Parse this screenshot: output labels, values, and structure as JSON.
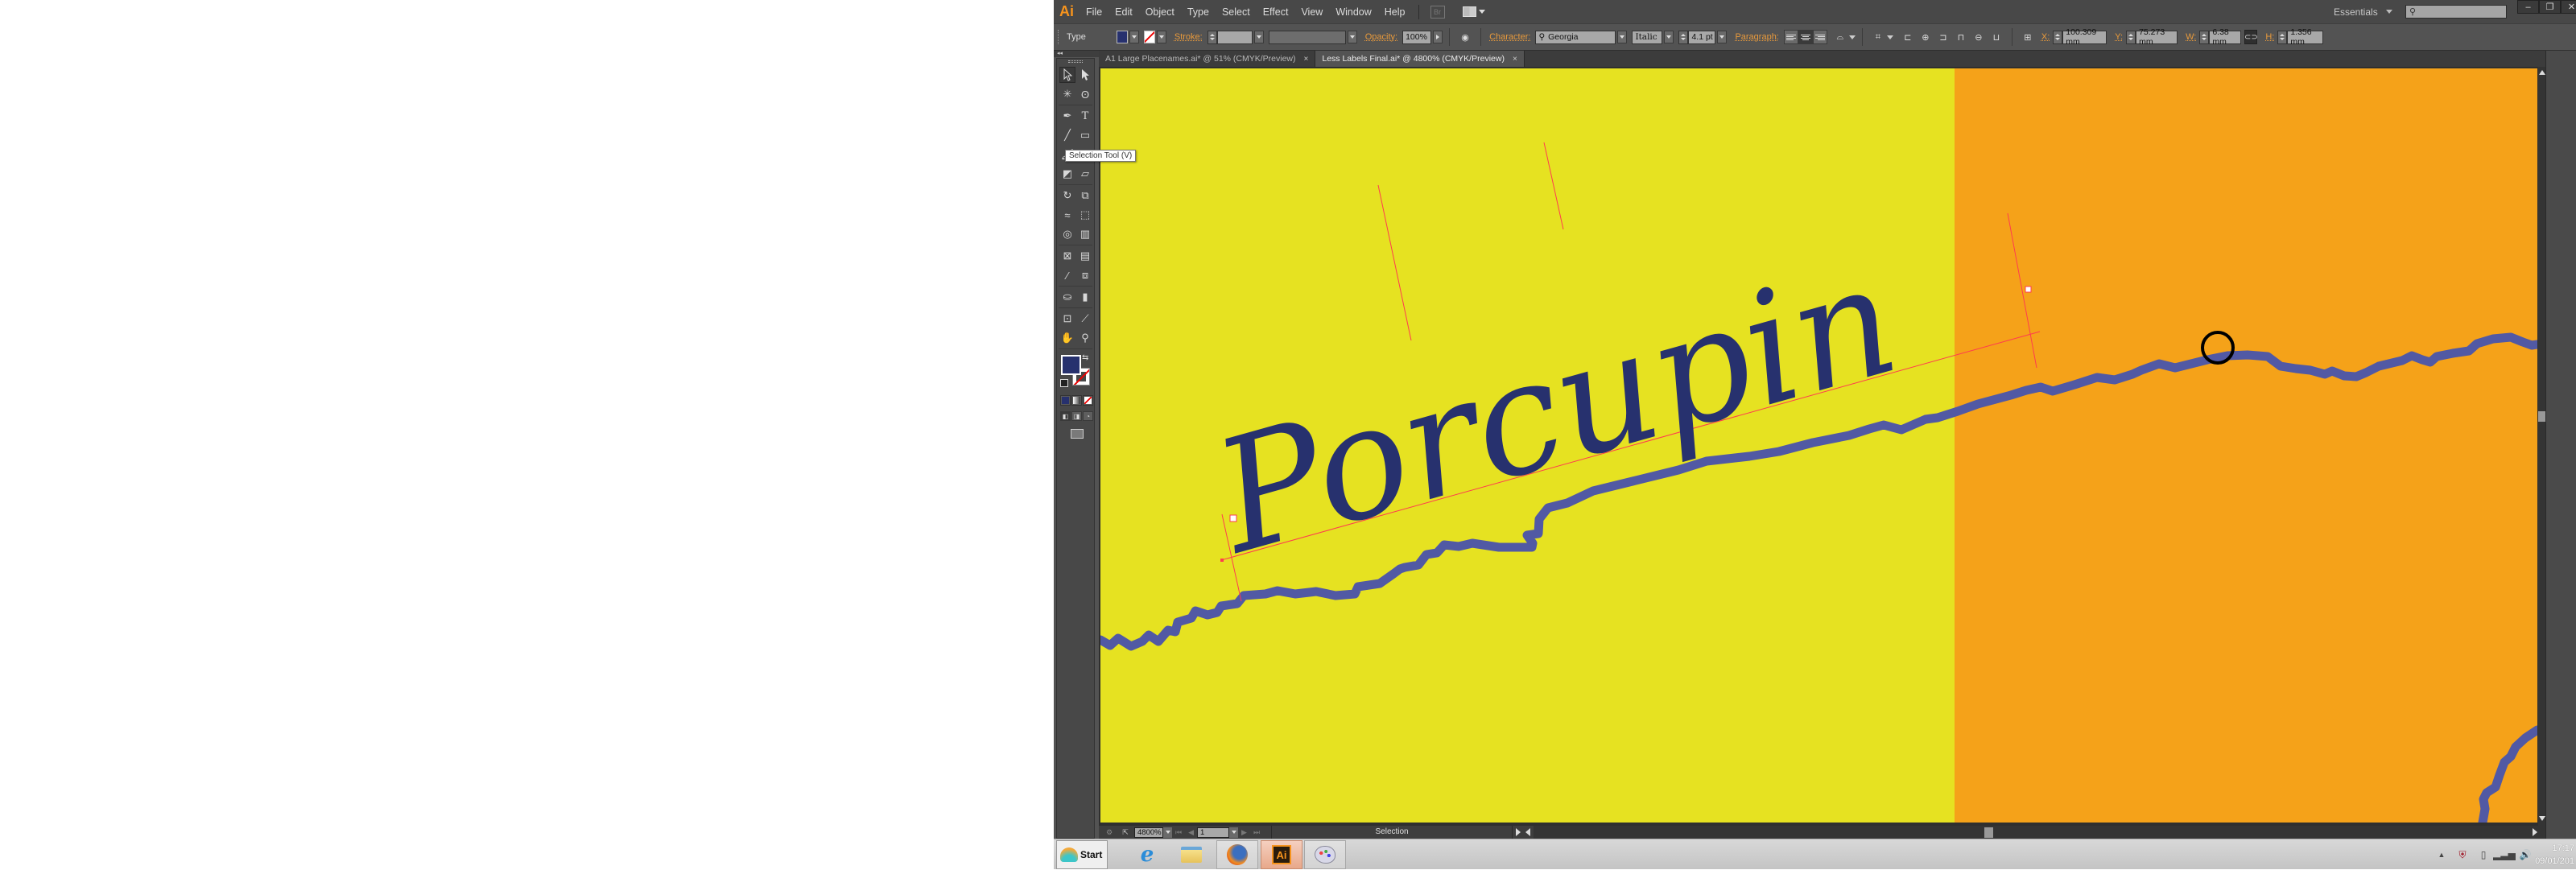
{
  "app": {
    "logo": "Ai",
    "menu": [
      "File",
      "Edit",
      "Object",
      "Type",
      "Select",
      "Effect",
      "View",
      "Window",
      "Help"
    ],
    "bridge_label": "Br",
    "workspace": "Essentials",
    "search_placeholder": "",
    "window_controls": {
      "minimize": "–",
      "restore": "❐",
      "close": "✕"
    }
  },
  "control_bar": {
    "selection_type": "Type",
    "fill_color": "#27316e",
    "stroke_label": "Stroke:",
    "stroke_weight": "",
    "stroke_style": "",
    "opacity_label": "Opacity:",
    "opacity_value": "100%",
    "character_label": "Character:",
    "font_family": "Georgia",
    "font_style": "Italic",
    "font_size": "4.1 pt",
    "paragraph_label": "Paragraph:",
    "paragraph_align": [
      "left",
      "center",
      "right"
    ],
    "paragraph_align_selected": "center",
    "x_label": "X:",
    "x_value": "100.309 mm",
    "y_label": "Y:",
    "y_value": "75.273 mm",
    "w_label": "W:",
    "w_value": "6.38 mm",
    "h_label": "H:",
    "h_value": "1.356 mm"
  },
  "tabs": [
    {
      "label": "A1 Large Placenames.ai* @ 51% (CMYK/Preview)",
      "active": false,
      "close": "×"
    },
    {
      "label": "Less Labels Final.ai* @ 4800% (CMYK/Preview)",
      "active": true,
      "close": "×"
    }
  ],
  "tools": {
    "tooltip": "Selection Tool (V)",
    "active": "selection",
    "fill_color": "#27316e",
    "stroke_color": "none"
  },
  "artwork": {
    "label_text": "Porcupin",
    "label_color": "#27316e",
    "region_colors": {
      "left": "#e6e221",
      "right": "#f5a219"
    },
    "river_color": "#5159a4",
    "marker_color": "#000000",
    "path_guide_color": "#ff3b4f"
  },
  "statusbar": {
    "zoom": "4800%",
    "artboard": "1",
    "status": "Selection"
  },
  "taskbar": {
    "start_label": "Start",
    "apps": [
      "internet-explorer",
      "file-explorer",
      "firefox",
      "adobe-illustrator",
      "paint"
    ],
    "active_app": "adobe-illustrator",
    "ai_label": "Ai",
    "clock_time": "17:17",
    "clock_date": "09/01/201"
  }
}
